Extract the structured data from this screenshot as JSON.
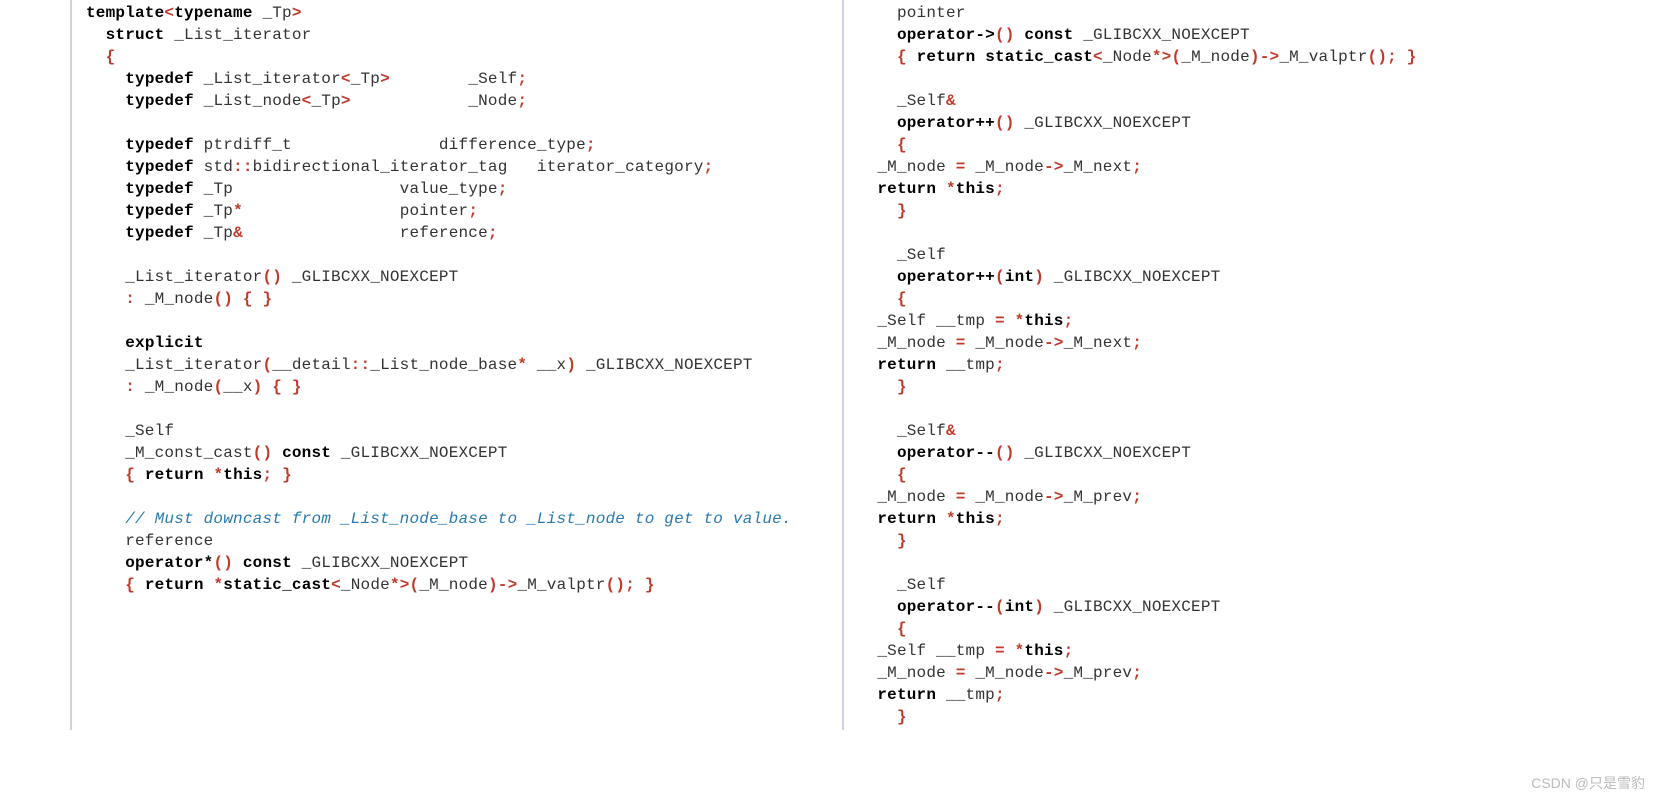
{
  "left": {
    "lines": [
      [
        {
          "t": "template",
          "c": "kw"
        },
        {
          "t": "<",
          "c": "op"
        },
        {
          "t": "typename",
          "c": "kw"
        },
        {
          "t": " _Tp",
          "c": "id"
        },
        {
          "t": ">",
          "c": "op"
        }
      ],
      [
        {
          "t": "  ",
          "c": ""
        },
        {
          "t": "struct",
          "c": "kw"
        },
        {
          "t": " _List_iterator",
          "c": "id"
        }
      ],
      [
        {
          "t": "  ",
          "c": ""
        },
        {
          "t": "{",
          "c": "punc"
        }
      ],
      [
        {
          "t": "    ",
          "c": ""
        },
        {
          "t": "typedef",
          "c": "kw"
        },
        {
          "t": " _List_iterator",
          "c": "id"
        },
        {
          "t": "<",
          "c": "op"
        },
        {
          "t": "_Tp",
          "c": "id"
        },
        {
          "t": ">",
          "c": "op"
        },
        {
          "t": "        _Self",
          "c": "id"
        },
        {
          "t": ";",
          "c": "punc"
        }
      ],
      [
        {
          "t": "    ",
          "c": ""
        },
        {
          "t": "typedef",
          "c": "kw"
        },
        {
          "t": " _List_node",
          "c": "id"
        },
        {
          "t": "<",
          "c": "op"
        },
        {
          "t": "_Tp",
          "c": "id"
        },
        {
          "t": ">",
          "c": "op"
        },
        {
          "t": "            _Node",
          "c": "id"
        },
        {
          "t": ";",
          "c": "punc"
        }
      ],
      [
        {
          "t": " ",
          "c": ""
        }
      ],
      [
        {
          "t": "    ",
          "c": ""
        },
        {
          "t": "typedef",
          "c": "kw"
        },
        {
          "t": " ptrdiff_t               difference_type",
          "c": "id"
        },
        {
          "t": ";",
          "c": "punc"
        }
      ],
      [
        {
          "t": "    ",
          "c": ""
        },
        {
          "t": "typedef",
          "c": "kw"
        },
        {
          "t": " std",
          "c": "id"
        },
        {
          "t": "::",
          "c": "punc"
        },
        {
          "t": "bidirectional_iterator_tag   iterator_category",
          "c": "id"
        },
        {
          "t": ";",
          "c": "punc"
        }
      ],
      [
        {
          "t": "    ",
          "c": ""
        },
        {
          "t": "typedef",
          "c": "kw"
        },
        {
          "t": " _Tp                 value_type",
          "c": "id"
        },
        {
          "t": ";",
          "c": "punc"
        }
      ],
      [
        {
          "t": "    ",
          "c": ""
        },
        {
          "t": "typedef",
          "c": "kw"
        },
        {
          "t": " _Tp",
          "c": "id"
        },
        {
          "t": "*",
          "c": "op"
        },
        {
          "t": "                pointer",
          "c": "id"
        },
        {
          "t": ";",
          "c": "punc"
        }
      ],
      [
        {
          "t": "    ",
          "c": ""
        },
        {
          "t": "typedef",
          "c": "kw"
        },
        {
          "t": " _Tp",
          "c": "id"
        },
        {
          "t": "&",
          "c": "op"
        },
        {
          "t": "                reference",
          "c": "id"
        },
        {
          "t": ";",
          "c": "punc"
        }
      ],
      [
        {
          "t": " ",
          "c": ""
        }
      ],
      [
        {
          "t": "    _List_iterator",
          "c": "id"
        },
        {
          "t": "()",
          "c": "punc"
        },
        {
          "t": " _GLIBCXX_NOEXCEPT",
          "c": "id"
        }
      ],
      [
        {
          "t": "    ",
          "c": ""
        },
        {
          "t": ":",
          "c": "punc"
        },
        {
          "t": " _M_node",
          "c": "id"
        },
        {
          "t": "() { }",
          "c": "punc"
        }
      ],
      [
        {
          "t": " ",
          "c": ""
        }
      ],
      [
        {
          "t": "    ",
          "c": ""
        },
        {
          "t": "explicit",
          "c": "kw"
        }
      ],
      [
        {
          "t": "    _List_iterator",
          "c": "id"
        },
        {
          "t": "(",
          "c": "punc"
        },
        {
          "t": "__detail",
          "c": "id"
        },
        {
          "t": "::",
          "c": "punc"
        },
        {
          "t": "_List_node_base",
          "c": "id"
        },
        {
          "t": "*",
          "c": "op"
        },
        {
          "t": " __x",
          "c": "id"
        },
        {
          "t": ")",
          "c": "punc"
        },
        {
          "t": " _GLIBCXX_NOEXCEPT",
          "c": "id"
        }
      ],
      [
        {
          "t": "    ",
          "c": ""
        },
        {
          "t": ":",
          "c": "punc"
        },
        {
          "t": " _M_node",
          "c": "id"
        },
        {
          "t": "(",
          "c": "punc"
        },
        {
          "t": "__x",
          "c": "id"
        },
        {
          "t": ") { }",
          "c": "punc"
        }
      ],
      [
        {
          "t": " ",
          "c": ""
        }
      ],
      [
        {
          "t": "    _Self",
          "c": "id"
        }
      ],
      [
        {
          "t": "    _M_const_cast",
          "c": "id"
        },
        {
          "t": "()",
          "c": "punc"
        },
        {
          "t": " ",
          "c": ""
        },
        {
          "t": "const",
          "c": "kw"
        },
        {
          "t": " _GLIBCXX_NOEXCEPT",
          "c": "id"
        }
      ],
      [
        {
          "t": "    ",
          "c": ""
        },
        {
          "t": "{",
          "c": "punc"
        },
        {
          "t": " ",
          "c": ""
        },
        {
          "t": "return",
          "c": "kw"
        },
        {
          "t": " ",
          "c": ""
        },
        {
          "t": "*",
          "c": "op"
        },
        {
          "t": "this",
          "c": "kw"
        },
        {
          "t": ";",
          "c": "punc"
        },
        {
          "t": " ",
          "c": ""
        },
        {
          "t": "}",
          "c": "punc"
        }
      ],
      [
        {
          "t": " ",
          "c": ""
        }
      ],
      [
        {
          "t": "    ",
          "c": ""
        },
        {
          "t": "// Must downcast from _List_node_base to _List_node to get to value.",
          "c": "comment"
        }
      ],
      [
        {
          "t": "    reference",
          "c": "id"
        }
      ],
      [
        {
          "t": "    ",
          "c": ""
        },
        {
          "t": "operator*",
          "c": "kw"
        },
        {
          "t": "()",
          "c": "punc"
        },
        {
          "t": " ",
          "c": ""
        },
        {
          "t": "const",
          "c": "kw"
        },
        {
          "t": " _GLIBCXX_NOEXCEPT",
          "c": "id"
        }
      ],
      [
        {
          "t": "    ",
          "c": ""
        },
        {
          "t": "{",
          "c": "punc"
        },
        {
          "t": " ",
          "c": ""
        },
        {
          "t": "return",
          "c": "kw"
        },
        {
          "t": " ",
          "c": ""
        },
        {
          "t": "*",
          "c": "op"
        },
        {
          "t": "static_cast",
          "c": "kw"
        },
        {
          "t": "<",
          "c": "op"
        },
        {
          "t": "_Node",
          "c": "id"
        },
        {
          "t": "*",
          "c": "op"
        },
        {
          "t": ">(",
          "c": "punc"
        },
        {
          "t": "_M_node",
          "c": "id"
        },
        {
          "t": ")->",
          "c": "punc"
        },
        {
          "t": "_M_valptr",
          "c": "id"
        },
        {
          "t": "();",
          "c": "punc"
        },
        {
          "t": " ",
          "c": ""
        },
        {
          "t": "}",
          "c": "punc"
        }
      ]
    ]
  },
  "right": {
    "lines": [
      [
        {
          "t": "    pointer",
          "c": "id"
        }
      ],
      [
        {
          "t": "    ",
          "c": ""
        },
        {
          "t": "operator->",
          "c": "kw"
        },
        {
          "t": "()",
          "c": "punc"
        },
        {
          "t": " ",
          "c": ""
        },
        {
          "t": "const",
          "c": "kw"
        },
        {
          "t": " _GLIBCXX_NOEXCEPT",
          "c": "id"
        }
      ],
      [
        {
          "t": "    ",
          "c": ""
        },
        {
          "t": "{",
          "c": "punc"
        },
        {
          "t": " ",
          "c": ""
        },
        {
          "t": "return",
          "c": "kw"
        },
        {
          "t": " ",
          "c": ""
        },
        {
          "t": "static_cast",
          "c": "kw"
        },
        {
          "t": "<",
          "c": "op"
        },
        {
          "t": "_Node",
          "c": "id"
        },
        {
          "t": "*",
          "c": "op"
        },
        {
          "t": ">(",
          "c": "punc"
        },
        {
          "t": "_M_node",
          "c": "id"
        },
        {
          "t": ")->",
          "c": "punc"
        },
        {
          "t": "_M_valptr",
          "c": "id"
        },
        {
          "t": "();",
          "c": "punc"
        },
        {
          "t": " ",
          "c": ""
        },
        {
          "t": "}",
          "c": "punc"
        }
      ],
      [
        {
          "t": " ",
          "c": ""
        }
      ],
      [
        {
          "t": "    _Self",
          "c": "id"
        },
        {
          "t": "&",
          "c": "op"
        }
      ],
      [
        {
          "t": "    ",
          "c": ""
        },
        {
          "t": "operator++",
          "c": "kw"
        },
        {
          "t": "()",
          "c": "punc"
        },
        {
          "t": " _GLIBCXX_NOEXCEPT",
          "c": "id"
        }
      ],
      [
        {
          "t": "    ",
          "c": ""
        },
        {
          "t": "{",
          "c": "punc"
        }
      ],
      [
        {
          "t": "  _M_node ",
          "c": "id"
        },
        {
          "t": "=",
          "c": "op"
        },
        {
          "t": " _M_node",
          "c": "id"
        },
        {
          "t": "->",
          "c": "punc"
        },
        {
          "t": "_M_next",
          "c": "id"
        },
        {
          "t": ";",
          "c": "punc"
        }
      ],
      [
        {
          "t": "  ",
          "c": ""
        },
        {
          "t": "return",
          "c": "kw"
        },
        {
          "t": " ",
          "c": ""
        },
        {
          "t": "*",
          "c": "op"
        },
        {
          "t": "this",
          "c": "kw"
        },
        {
          "t": ";",
          "c": "punc"
        }
      ],
      [
        {
          "t": "    ",
          "c": ""
        },
        {
          "t": "}",
          "c": "punc"
        }
      ],
      [
        {
          "t": " ",
          "c": ""
        }
      ],
      [
        {
          "t": "    _Self",
          "c": "id"
        }
      ],
      [
        {
          "t": "    ",
          "c": ""
        },
        {
          "t": "operator++",
          "c": "kw"
        },
        {
          "t": "(",
          "c": "punc"
        },
        {
          "t": "int",
          "c": "kw"
        },
        {
          "t": ")",
          "c": "punc"
        },
        {
          "t": " _GLIBCXX_NOEXCEPT",
          "c": "id"
        }
      ],
      [
        {
          "t": "    ",
          "c": ""
        },
        {
          "t": "{",
          "c": "punc"
        }
      ],
      [
        {
          "t": "  _Self __tmp ",
          "c": "id"
        },
        {
          "t": "=",
          "c": "op"
        },
        {
          "t": " ",
          "c": ""
        },
        {
          "t": "*",
          "c": "op"
        },
        {
          "t": "this",
          "c": "kw"
        },
        {
          "t": ";",
          "c": "punc"
        }
      ],
      [
        {
          "t": "  _M_node ",
          "c": "id"
        },
        {
          "t": "=",
          "c": "op"
        },
        {
          "t": " _M_node",
          "c": "id"
        },
        {
          "t": "->",
          "c": "punc"
        },
        {
          "t": "_M_next",
          "c": "id"
        },
        {
          "t": ";",
          "c": "punc"
        }
      ],
      [
        {
          "t": "  ",
          "c": ""
        },
        {
          "t": "return",
          "c": "kw"
        },
        {
          "t": " __tmp",
          "c": "id"
        },
        {
          "t": ";",
          "c": "punc"
        }
      ],
      [
        {
          "t": "    ",
          "c": ""
        },
        {
          "t": "}",
          "c": "punc"
        }
      ],
      [
        {
          "t": " ",
          "c": ""
        }
      ],
      [
        {
          "t": "    _Self",
          "c": "id"
        },
        {
          "t": "&",
          "c": "op"
        }
      ],
      [
        {
          "t": "    ",
          "c": ""
        },
        {
          "t": "operator--",
          "c": "kw"
        },
        {
          "t": "()",
          "c": "punc"
        },
        {
          "t": " _GLIBCXX_NOEXCEPT",
          "c": "id"
        }
      ],
      [
        {
          "t": "    ",
          "c": ""
        },
        {
          "t": "{",
          "c": "punc"
        }
      ],
      [
        {
          "t": "  _M_node ",
          "c": "id"
        },
        {
          "t": "=",
          "c": "op"
        },
        {
          "t": " _M_node",
          "c": "id"
        },
        {
          "t": "->",
          "c": "punc"
        },
        {
          "t": "_M_prev",
          "c": "id"
        },
        {
          "t": ";",
          "c": "punc"
        }
      ],
      [
        {
          "t": "  ",
          "c": ""
        },
        {
          "t": "return",
          "c": "kw"
        },
        {
          "t": " ",
          "c": ""
        },
        {
          "t": "*",
          "c": "op"
        },
        {
          "t": "this",
          "c": "kw"
        },
        {
          "t": ";",
          "c": "punc"
        }
      ],
      [
        {
          "t": "    ",
          "c": ""
        },
        {
          "t": "}",
          "c": "punc"
        }
      ],
      [
        {
          "t": " ",
          "c": ""
        }
      ],
      [
        {
          "t": "    _Self",
          "c": "id"
        }
      ],
      [
        {
          "t": "    ",
          "c": ""
        },
        {
          "t": "operator--",
          "c": "kw"
        },
        {
          "t": "(",
          "c": "punc"
        },
        {
          "t": "int",
          "c": "kw"
        },
        {
          "t": ")",
          "c": "punc"
        },
        {
          "t": " _GLIBCXX_NOEXCEPT",
          "c": "id"
        }
      ],
      [
        {
          "t": "    ",
          "c": ""
        },
        {
          "t": "{",
          "c": "punc"
        }
      ],
      [
        {
          "t": "  _Self __tmp ",
          "c": "id"
        },
        {
          "t": "=",
          "c": "op"
        },
        {
          "t": " ",
          "c": ""
        },
        {
          "t": "*",
          "c": "op"
        },
        {
          "t": "this",
          "c": "kw"
        },
        {
          "t": ";",
          "c": "punc"
        }
      ],
      [
        {
          "t": "  _M_node ",
          "c": "id"
        },
        {
          "t": "=",
          "c": "op"
        },
        {
          "t": " _M_node",
          "c": "id"
        },
        {
          "t": "->",
          "c": "punc"
        },
        {
          "t": "_M_prev",
          "c": "id"
        },
        {
          "t": ";",
          "c": "punc"
        }
      ],
      [
        {
          "t": "  ",
          "c": ""
        },
        {
          "t": "return",
          "c": "kw"
        },
        {
          "t": " __tmp",
          "c": "id"
        },
        {
          "t": ";",
          "c": "punc"
        }
      ],
      [
        {
          "t": "    ",
          "c": ""
        },
        {
          "t": "}",
          "c": "punc"
        }
      ]
    ]
  },
  "watermark": "CSDN @只是雪豹"
}
